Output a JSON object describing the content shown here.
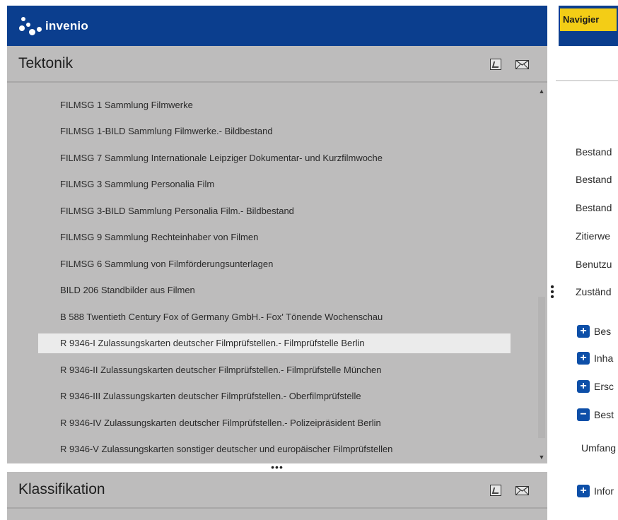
{
  "brand": {
    "name": "invenio"
  },
  "tektonik": {
    "title": "Tektonik",
    "icons": [
      "pdf-export-icon",
      "mail-icon"
    ],
    "items": [
      {
        "label": "FILMSG 1 Sammlung Filmwerke"
      },
      {
        "label": "FILMSG 1-BILD Sammlung Filmwerke.- Bildbestand"
      },
      {
        "label": "FILMSG 7 Sammlung Internationale Leipziger Dokumentar- und Kurzfilmwoche"
      },
      {
        "label": "FILMSG 3 Sammlung Personalia Film"
      },
      {
        "label": "FILMSG 3-BILD Sammlung Personalia Film.- Bildbestand"
      },
      {
        "label": "FILMSG 9 Sammlung Rechteinhaber von Filmen"
      },
      {
        "label": "FILMSG 6 Sammlung von Filmförderungsunterlagen"
      },
      {
        "label": "BILD 206 Standbilder aus Filmen"
      },
      {
        "label": "B 588 Twentieth Century Fox of Germany GmbH.- Fox' Tönende Wochenschau"
      },
      {
        "label": "R 9346-I Zulassungskarten deutscher Filmprüfstellen.- Filmprüfstelle Berlin",
        "selected": true
      },
      {
        "label": "R 9346-II Zulassungskarten deutscher Filmprüfstellen.- Filmprüfstelle München"
      },
      {
        "label": "R 9346-III Zulassungskarten deutscher Filmprüfstellen.- Oberfilmprüfstelle"
      },
      {
        "label": "R 9346-IV Zulassungskarten deutscher Filmprüfstellen.- Polizeipräsident Berlin"
      },
      {
        "label": "R 9346-V Zulassungskarten sonstiger deutscher und europäischer Filmprüfstellen"
      }
    ]
  },
  "klassifikation": {
    "title": "Klassifikation"
  },
  "right_panel": {
    "nav_button": "Navigier",
    "meta_labels": [
      "Bestand",
      "Bestand",
      "Bestand",
      "Zitierwe",
      "Benutzu",
      "Zuständ"
    ],
    "expanders": [
      {
        "symbol": "+",
        "label": "Bes"
      },
      {
        "symbol": "+",
        "label": "Inha"
      },
      {
        "symbol": "+",
        "label": "Ersc"
      },
      {
        "symbol": "−",
        "label": "Best"
      }
    ],
    "umfang_label": "Umfang",
    "info_expander": {
      "symbol": "+",
      "label": "Infor"
    }
  },
  "colors": {
    "brand_blue": "#0b3e8e",
    "nav_yellow": "#f3cd16",
    "panel_grey": "#bdbcbc",
    "selected_row": "#ebebeb",
    "button_blue": "#0d4fa8"
  }
}
